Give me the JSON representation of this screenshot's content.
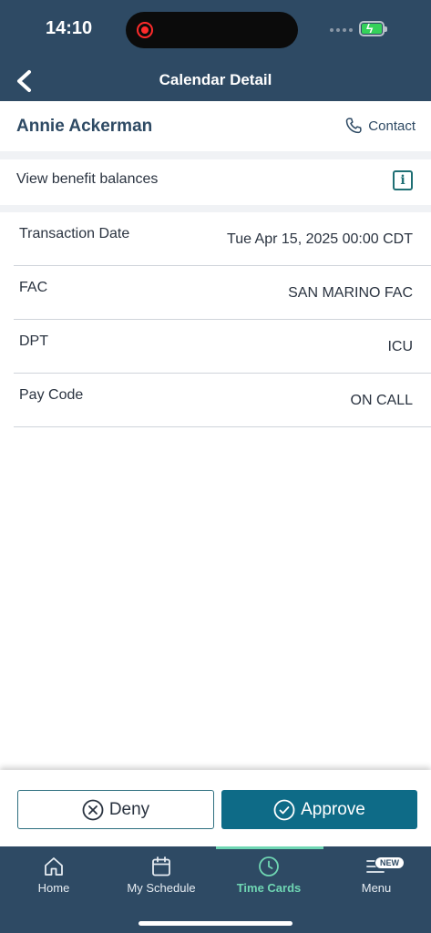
{
  "status_bar": {
    "time": "14:10"
  },
  "header": {
    "title": "Calendar Detail"
  },
  "employee": {
    "name": "Annie Ackerman",
    "contact_label": "Contact"
  },
  "benefit": {
    "label": "View benefit balances"
  },
  "details": [
    {
      "label": "Transaction Date",
      "value": "Tue Apr 15, 2025 00:00 CDT"
    },
    {
      "label": "FAC",
      "value": "SAN MARINO FAC"
    },
    {
      "label": "DPT",
      "value": "ICU"
    },
    {
      "label": "Pay Code",
      "value": "ON CALL"
    }
  ],
  "actions": {
    "deny_label": "Deny",
    "approve_label": "Approve"
  },
  "nav": {
    "items": [
      {
        "label": "Home",
        "icon": "home-icon"
      },
      {
        "label": "My Schedule",
        "icon": "calendar-icon"
      },
      {
        "label": "Time Cards",
        "icon": "clock-icon"
      },
      {
        "label": "Menu",
        "icon": "menu-icon"
      }
    ],
    "menu_badge": "NEW",
    "active": "Time Cards"
  },
  "colors": {
    "header_bg": "#2e4a64",
    "accent": "#0e6b87",
    "active_nav": "#6fd6b3"
  }
}
